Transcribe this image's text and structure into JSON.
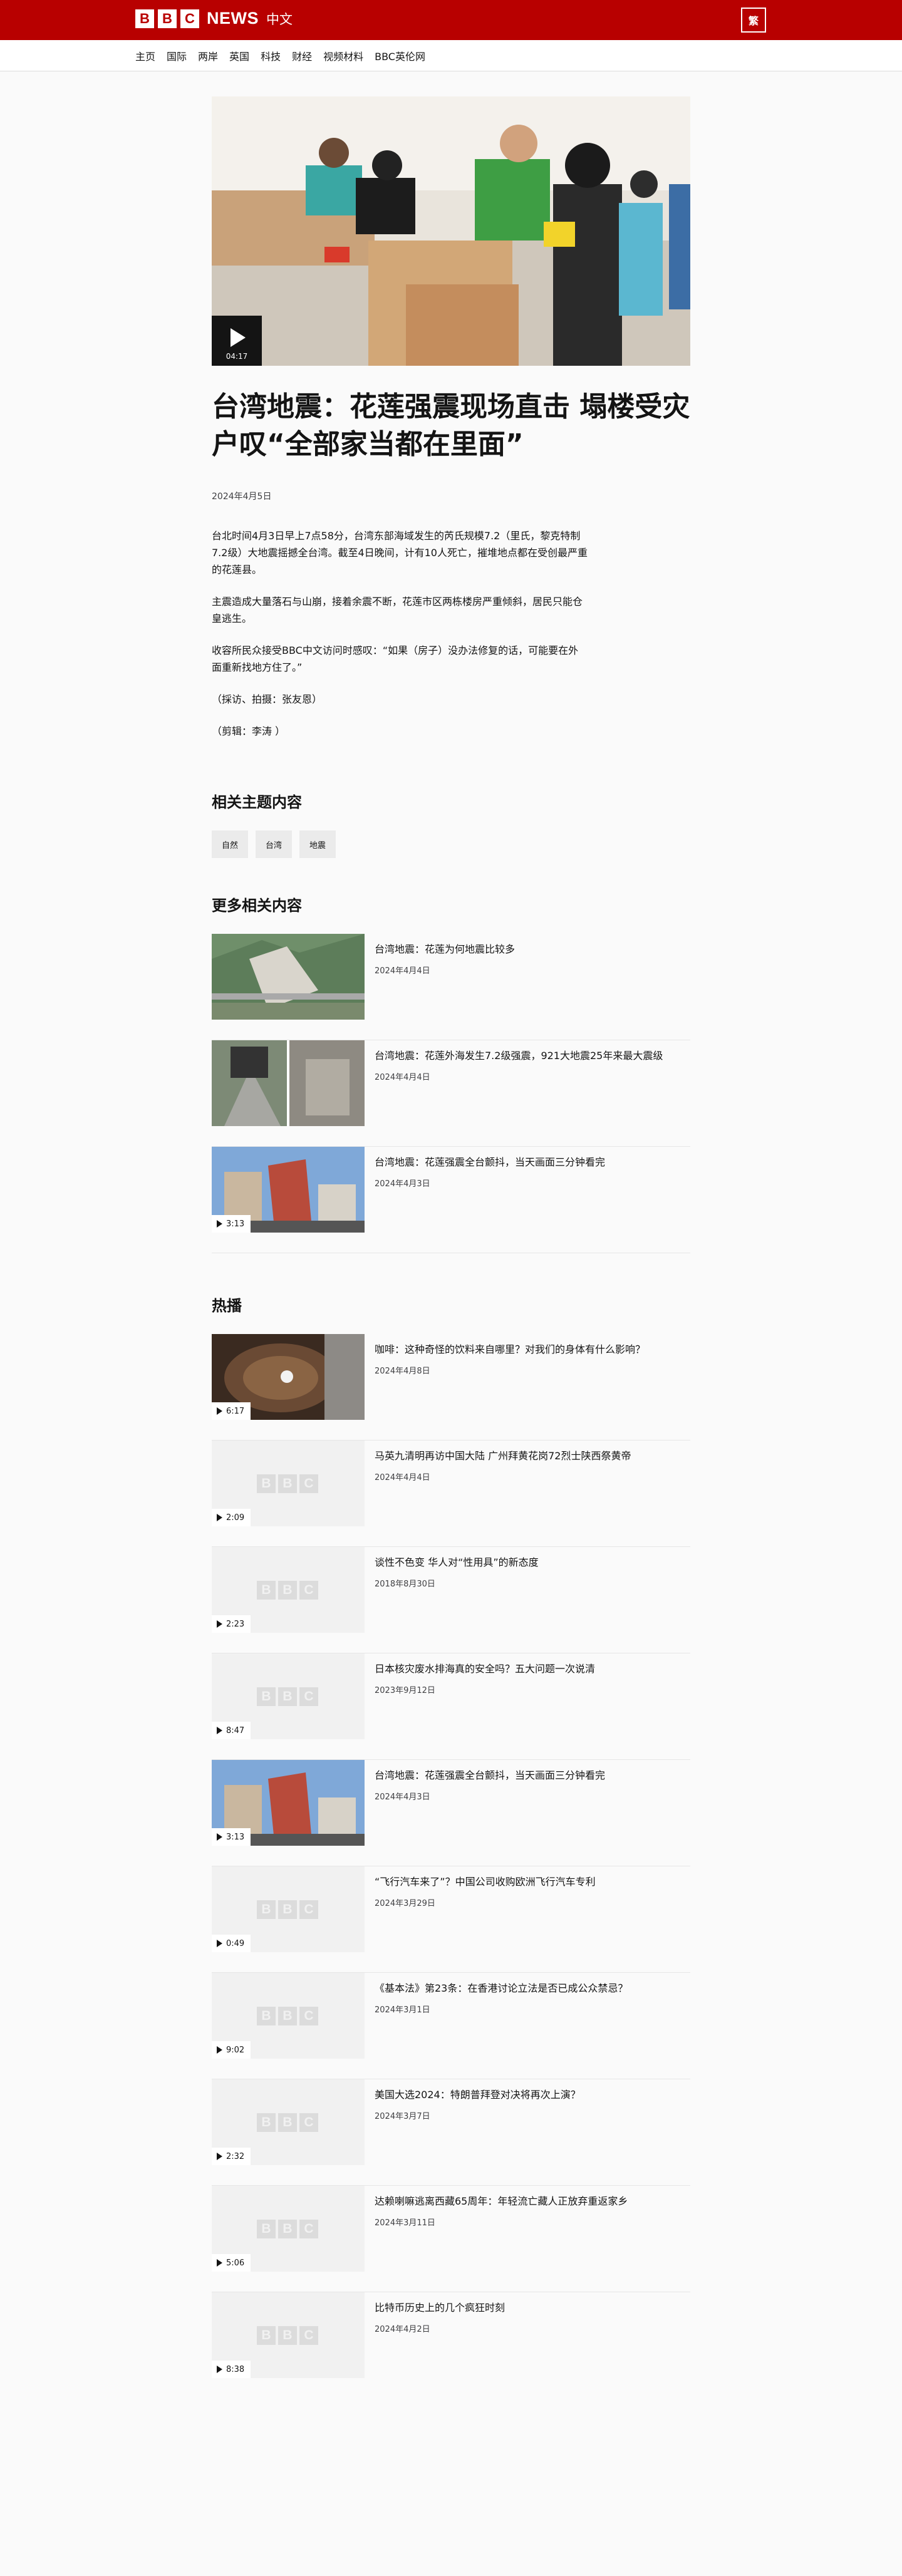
{
  "header": {
    "logo_letters": [
      "B",
      "B",
      "C"
    ],
    "logo_news": "NEWS",
    "logo_zh": "中文",
    "script_toggle": "繁"
  },
  "nav": [
    "主页",
    "国际",
    "两岸",
    "英国",
    "科技",
    "财经",
    "视频材料",
    "BBC英伦网"
  ],
  "article": {
    "video_duration": "04:17",
    "title": "台湾地震：花莲强震现场直击 塌楼受灾户叹“全部家当都在里面”",
    "date": "2024年4月5日",
    "paragraphs": [
      "台北时间4月3日早上7点58分，台湾东部海域发生的芮氏规模7.2（里氏，黎克特制7.2级）大地震摇撼全台湾。截至4日晚间，计有10人死亡，摧堆地点都在受创最严重的花莲县。",
      "主震造成大量落石与山崩，接着余震不断，花莲市区两栋楼房严重倾斜，居民只能仓皇逃生。",
      "收容所民众接受BBC中文访问时感叹：“如果（房子）没办法修复的话，可能要在外面重新找地方住了。”",
      "（採访、拍摄：张友恩）",
      "（剪辑：李涛 ）"
    ]
  },
  "related_topics": {
    "heading": "相关主题内容",
    "tags": [
      "自然",
      "台湾",
      "地震"
    ]
  },
  "more_related": {
    "heading": "更多相关内容",
    "items": [
      {
        "headline": "台湾地震：花莲为何地震比较多",
        "date": "2024年4月4日",
        "duration": ""
      },
      {
        "headline": "台湾地震：花莲外海发生7.2级强震，921大地震25年来最大震级",
        "date": "2024年4月4日",
        "duration": ""
      },
      {
        "headline": "台湾地震：花莲强震全台颤抖，当天画面三分钟看完",
        "date": "2024年4月3日",
        "duration": "3:13"
      }
    ]
  },
  "hot": {
    "heading": "热播",
    "items": [
      {
        "headline": "咖啡：这种奇怪的饮料来自哪里？对我们的身体有什么影响？",
        "date": "2024年4月8日",
        "duration": "6:17"
      },
      {
        "headline": "马英九清明再访中国大陆 广州拜黄花岗72烈士陕西祭黄帝",
        "date": "2024年4月4日",
        "duration": "2:09"
      },
      {
        "headline": "谈性不色变 华人对“性用具”的新态度",
        "date": "2018年8月30日",
        "duration": "2:23"
      },
      {
        "headline": "日本核灾废水排海真的安全吗？五大问题一次说清",
        "date": "2023年9月12日",
        "duration": "8:47"
      },
      {
        "headline": "台湾地震：花莲强震全台颤抖，当天画面三分钟看完",
        "date": "2024年4月3日",
        "duration": "3:13"
      },
      {
        "headline": "“飞行汽车来了”？中国公司收购欧洲飞行汽车专利",
        "date": "2024年3月29日",
        "duration": "0:49"
      },
      {
        "headline": "《基本法》第23条：在香港讨论立法是否已成公众禁忌？",
        "date": "2024年3月1日",
        "duration": "9:02"
      },
      {
        "headline": "美国大选2024：特朗普拜登对决将再次上演？",
        "date": "2024年3月7日",
        "duration": "2:32"
      },
      {
        "headline": "达赖喇嘛逃离西藏65周年：年轻流亡藏人正放弃重返家乡",
        "date": "2024年3月11日",
        "duration": "5:06"
      },
      {
        "headline": "比特币历史上的几个疯狂时刻",
        "date": "2024年4月2日",
        "duration": "8:38"
      }
    ]
  }
}
